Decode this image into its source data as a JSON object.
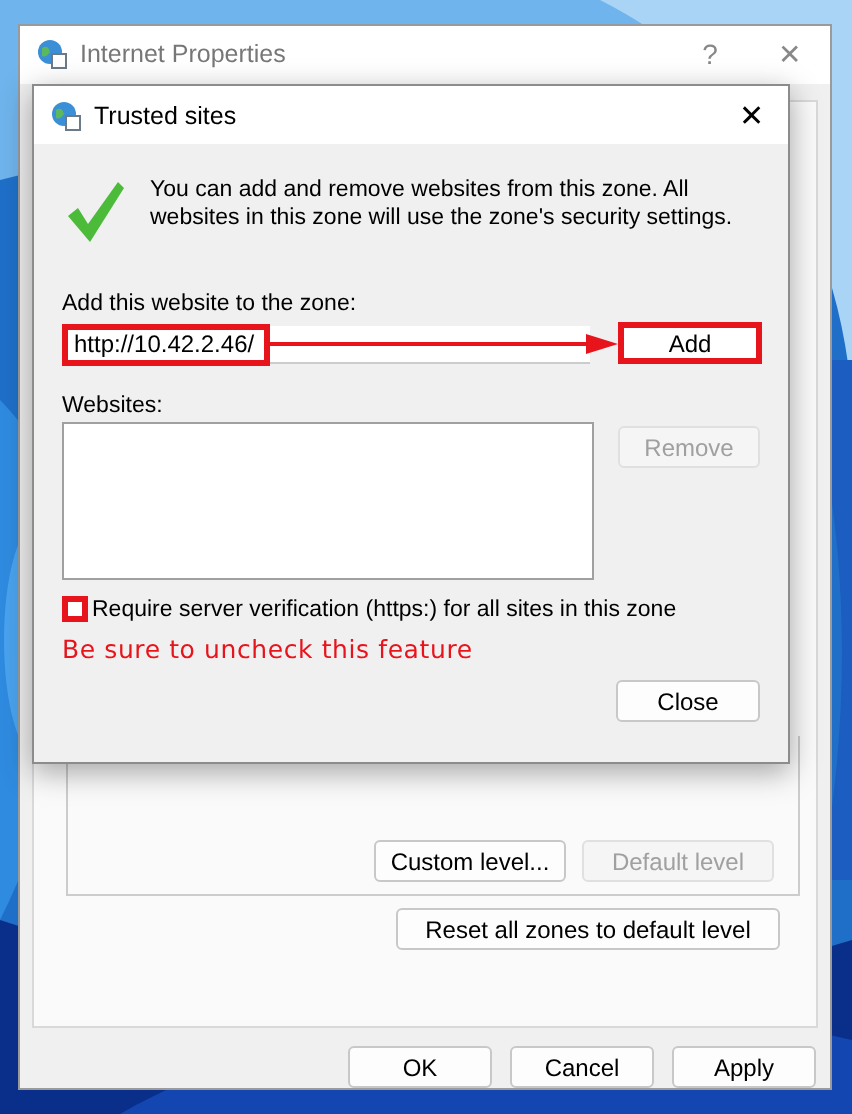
{
  "outer_window": {
    "title": "Internet Properties",
    "help": "?",
    "close": "✕",
    "level_buttons": [
      {
        "label": "Custom level...",
        "disabled": false
      },
      {
        "label": "Default level",
        "disabled": true
      }
    ],
    "reset_button": "Reset all zones to default level",
    "footer_buttons": [
      "OK",
      "Cancel",
      "Apply"
    ]
  },
  "dialog": {
    "title": "Trusted sites",
    "close": "✕",
    "description": "You can add and remove websites from this zone. All websites in this zone will use the zone's security settings.",
    "add_label": "Add this website to the zone:",
    "url_value": "http://10.42.2.46/",
    "add_button": {
      "label": "Add",
      "disabled": false
    },
    "websites_label": "Websites:",
    "remove_button": {
      "label": "Remove",
      "disabled": true
    },
    "require_https": {
      "label": "Require server verification (https:) for all sites in this zone",
      "checked": false
    },
    "close_button": "Close"
  },
  "annotation": {
    "note": "Be sure to uncheck this feature"
  }
}
